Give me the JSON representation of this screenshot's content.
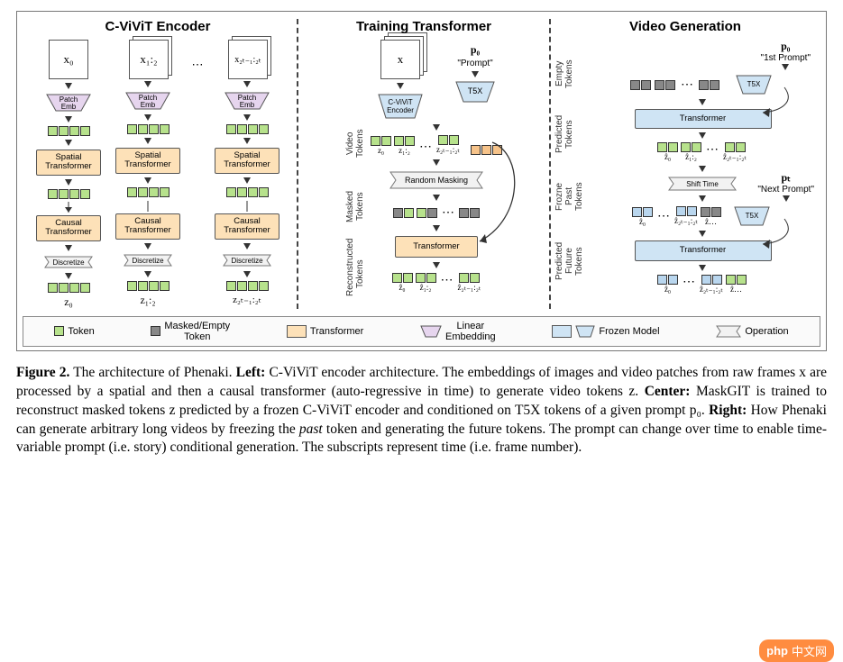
{
  "figure_label": "Figure 2.",
  "caption_text": " The architecture of Phenaki. ",
  "caption_left_lead": "Left:",
  "caption_left": " C-ViViT  encoder architecture. The embeddings of images and video patches from raw frames x are processed by a spatial and then a causal transformer (auto-regressive in time) to generate video tokens z. ",
  "caption_center_lead": "Center:",
  "caption_center": " MaskGIT is trained to reconstruct masked tokens z predicted by a frozen C-ViViT  encoder and conditioned on T5X tokens of a given prompt p₀. ",
  "caption_right_lead": "Right:",
  "caption_right": " How Phenaki can generate arbitrary long videos by freezing the ",
  "caption_right_em": "past",
  "caption_right2": " token and generating the future tokens. The prompt can change over time to enable time-variable prompt (i.e. story) conditional generation. The subscripts represent time (i.e. frame number).",
  "panel1": {
    "title": "C-ViViT Encoder",
    "x0": "x₀",
    "x12": "x₁:₂",
    "x2t": "x₂ₜ₋₁:₂ₜ",
    "patch": "Patch\nEmb",
    "spatial": "Spatial\nTransformer",
    "causal": "Causal\nTransformer",
    "discretize": "Discretize",
    "z0": "z₀",
    "z12": "z₁:₂",
    "z2t": "z₂ₜ₋₁:₂ₜ"
  },
  "panel2": {
    "title": "Training Transformer",
    "x": "x",
    "p0": "p₀",
    "prompt": "\"Prompt\"",
    "cvivit": "C-ViViT\nEncoder",
    "t5x": "T5X",
    "rand_mask": "Random Masking",
    "transformer": "Transformer",
    "side_video": "Video\nTokens",
    "side_masked": "Masked\nTokens",
    "side_rec": "Reconstructed\nTokens",
    "z0": "z₀",
    "z12": "z₁:₂",
    "z2t": "z₂ₜ₋₁:₂ₜ",
    "zh0": "ẑ₀",
    "zh12": "ẑ₁:₂",
    "zh2t": "ẑ₂ₜ₋₁:₂ₜ"
  },
  "panel3": {
    "title": "Video Generation",
    "p0": "p₀",
    "first_prompt": "\"1st Prompt\"",
    "pt": "pₜ",
    "next_prompt": "\"Next Prompt\"",
    "t5x": "T5X",
    "transformer": "Transformer",
    "shift": "Shift Time",
    "side_empty": "Empty\nTokens",
    "side_pred": "Predicted\nTokens",
    "side_frozen": "Frozne Past\nTokens",
    "side_future": "Predicted\nFuture Tokens",
    "zh0": "ẑ₀",
    "zh12": "ẑ₁:₂",
    "zh2t": "ẑ₂ₜ₋₁:₂ₜ",
    "zdots": "ẑ…"
  },
  "legend": {
    "token": "Token",
    "masked": "Masked/Empty\nToken",
    "transformer": "Transformer",
    "linear": "Linear\nEmbedding",
    "frozen": "Frozen Model",
    "operation": "Operation"
  },
  "watermark": {
    "brand": "php",
    "cn": "中文网"
  }
}
